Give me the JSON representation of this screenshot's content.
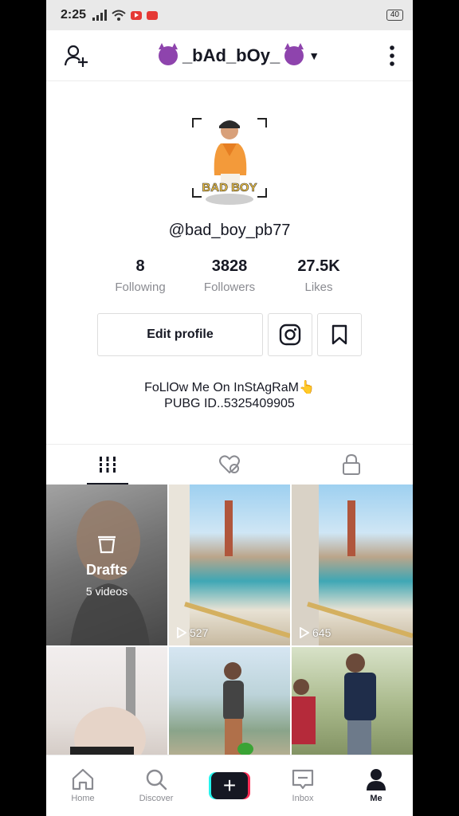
{
  "status_bar": {
    "time": "2:25",
    "battery": "40"
  },
  "header": {
    "title": "_bAd_bOy_",
    "add_user_icon": "person-add-icon",
    "more_icon": "more-vertical-icon"
  },
  "profile": {
    "avatar_text": "BAD BOY",
    "username": "@bad_boy_pb77",
    "stats": [
      {
        "value": "8",
        "label": "Following"
      },
      {
        "value": "3828",
        "label": "Followers"
      },
      {
        "value": "27.5K",
        "label": "Likes"
      }
    ],
    "edit_label": "Edit profile",
    "bio_line1": "FoLlOw Me On InStAgRaM👆",
    "bio_line2": "PUBG ID..5325409905"
  },
  "tabs": [
    "videos-grid-icon",
    "liked-hidden-icon",
    "lock-icon"
  ],
  "videos": {
    "drafts_title": "Drafts",
    "drafts_sub": "5 videos",
    "views": [
      "527",
      "645"
    ]
  },
  "nav": {
    "items": [
      {
        "label": "Home",
        "icon": "home-icon"
      },
      {
        "label": "Discover",
        "icon": "search-icon"
      },
      {
        "label": "",
        "icon": "create-plus-icon"
      },
      {
        "label": "Inbox",
        "icon": "inbox-icon"
      },
      {
        "label": "Me",
        "icon": "profile-icon"
      }
    ]
  },
  "colors": {
    "accent_cyan": "#25f4ee",
    "accent_red": "#fe2c55",
    "text_primary": "#161823",
    "text_secondary": "#8a8b91"
  }
}
